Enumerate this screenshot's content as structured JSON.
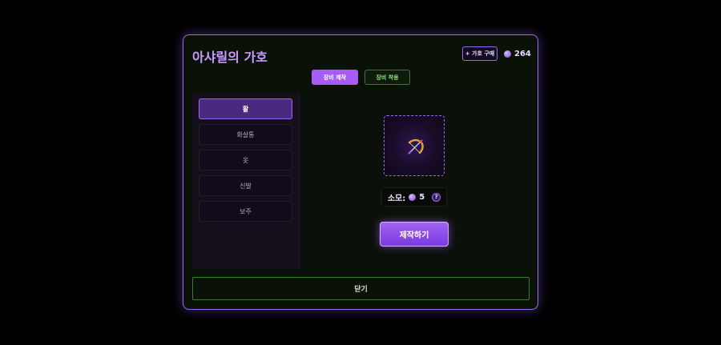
{
  "window": {
    "title": "아샤릴의 가호"
  },
  "header": {
    "buy_label": "+ 가호 구매",
    "currency_amount": "264",
    "currency_icon": "purple-orb-icon"
  },
  "tabs": [
    {
      "label": "장비 제작",
      "active": true
    },
    {
      "label": "장비 착용",
      "active": false
    }
  ],
  "sidebar": {
    "items": [
      {
        "label": "활",
        "active": true
      },
      {
        "label": "화살통",
        "active": false
      },
      {
        "label": "옷",
        "active": false
      },
      {
        "label": "신발",
        "active": false
      },
      {
        "label": "보주",
        "active": false
      }
    ]
  },
  "craft": {
    "item_icon": "bow-icon",
    "cost_label": "소모:",
    "cost_amount": "5",
    "help_label": "?",
    "craft_label": "제작하기"
  },
  "footer": {
    "close_label": "닫기"
  },
  "colors": {
    "accent": "#9b6af0",
    "brand_purple": "#a65cf5",
    "green_border": "#3d7a30",
    "background": "#000000"
  }
}
